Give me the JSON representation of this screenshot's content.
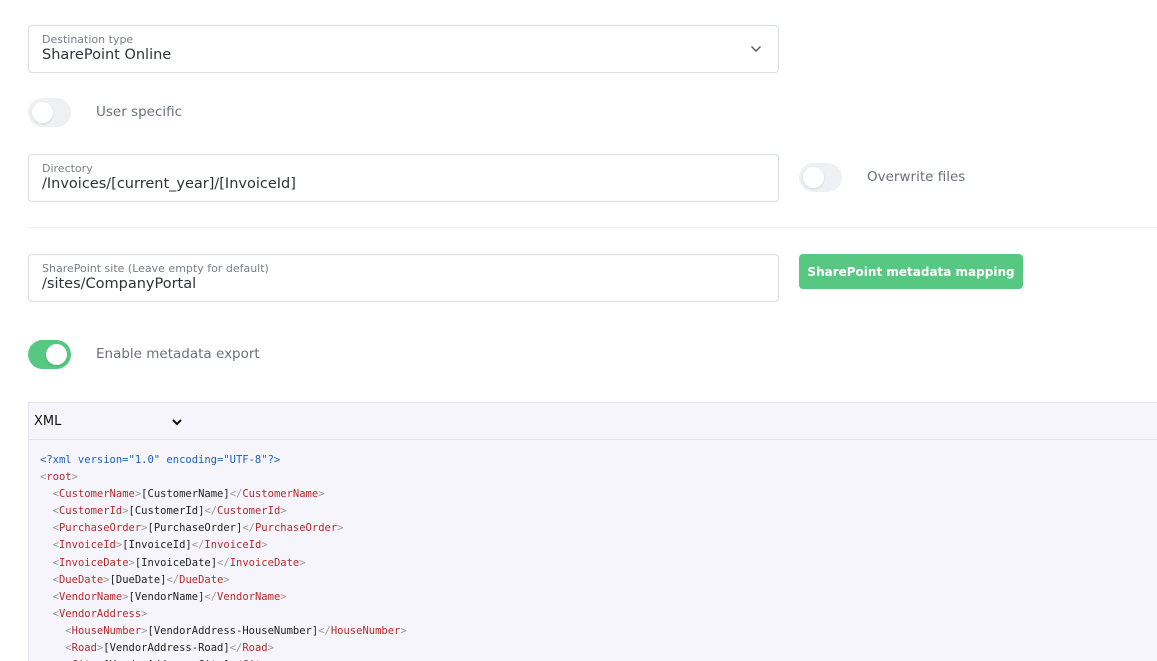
{
  "destination": {
    "label": "Destination type",
    "value": "SharePoint Online"
  },
  "user_specific": {
    "label": "User specific",
    "enabled": false
  },
  "directory": {
    "label": "Directory",
    "value": "/Invoices/[current_year]/[InvoiceId]"
  },
  "overwrite_files": {
    "label": "Overwrite files",
    "enabled": false
  },
  "sharepoint_site": {
    "label": "SharePoint site (Leave empty for default)",
    "value": "/sites/CompanyPortal"
  },
  "metadata_mapping_button": {
    "label": "SharePoint metadata mapping"
  },
  "metadata_export": {
    "label": "Enable metadata export",
    "enabled": true
  },
  "editor": {
    "format": "XML",
    "lines": [
      {
        "indent": 0,
        "type": "decl",
        "text": "<?xml version=\"1.0\" encoding=\"UTF-8\"?>"
      },
      {
        "indent": 0,
        "type": "open",
        "tag": "root"
      },
      {
        "indent": 1,
        "type": "elem",
        "tag": "CustomerName",
        "value": "[CustomerName]"
      },
      {
        "indent": 1,
        "type": "elem",
        "tag": "CustomerId",
        "value": "[CustomerId]"
      },
      {
        "indent": 1,
        "type": "elem",
        "tag": "PurchaseOrder",
        "value": "[PurchaseOrder]"
      },
      {
        "indent": 1,
        "type": "elem",
        "tag": "InvoiceId",
        "value": "[InvoiceId]"
      },
      {
        "indent": 1,
        "type": "elem",
        "tag": "InvoiceDate",
        "value": "[InvoiceDate]"
      },
      {
        "indent": 1,
        "type": "elem",
        "tag": "DueDate",
        "value": "[DueDate]"
      },
      {
        "indent": 1,
        "type": "elem",
        "tag": "VendorName",
        "value": "[VendorName]"
      },
      {
        "indent": 1,
        "type": "open",
        "tag": "VendorAddress"
      },
      {
        "indent": 2,
        "type": "elem",
        "tag": "HouseNumber",
        "value": "[VendorAddress-HouseNumber]"
      },
      {
        "indent": 2,
        "type": "elem",
        "tag": "Road",
        "value": "[VendorAddress-Road]"
      },
      {
        "indent": 2,
        "type": "elem",
        "tag": "City",
        "value": "[VendorAddress-City]"
      }
    ]
  },
  "colors": {
    "accent_green": "#56c882",
    "xml_tag": "#b52a2a",
    "xml_declaration": "#1e5fbf",
    "editor_background": "#f6f5fb"
  }
}
